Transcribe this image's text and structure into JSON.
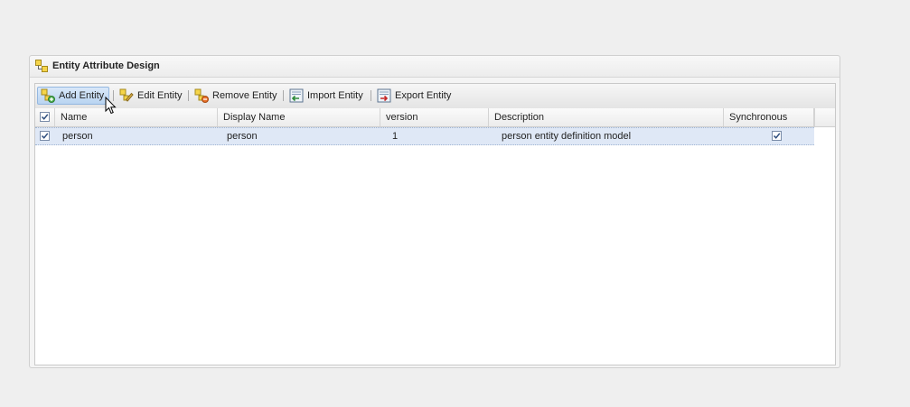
{
  "panel": {
    "title": "Entity Attribute Design",
    "icon": "entity-group-icon"
  },
  "toolbar": {
    "buttons": [
      {
        "label": "Add Entity",
        "icon": "add-entity-icon",
        "active": true
      },
      {
        "label": "Edit Entity",
        "icon": "edit-entity-icon",
        "active": false
      },
      {
        "label": "Remove Entity",
        "icon": "remove-entity-icon",
        "active": false
      },
      {
        "label": "Import Entity",
        "icon": "import-entity-icon",
        "active": false
      },
      {
        "label": "Export Entity",
        "icon": "export-entity-icon",
        "active": false
      }
    ]
  },
  "grid": {
    "header_checkbox_checked": true,
    "columns": [
      "Name",
      "Display Name",
      "version",
      "Description",
      "Synchronous"
    ],
    "rows": [
      {
        "checked": true,
        "name": "person",
        "display_name": "person",
        "version": "1",
        "description": "person entity definition model",
        "synchronous": true
      }
    ]
  },
  "colors": {
    "selected_row": "#dfe8f6",
    "active_button": "#c6dcf5"
  }
}
